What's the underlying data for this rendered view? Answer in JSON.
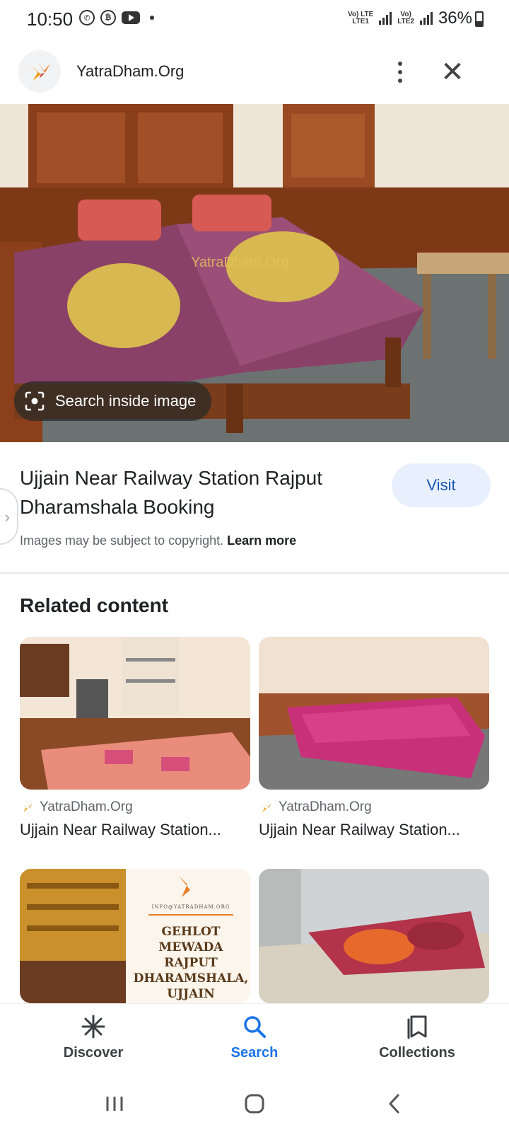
{
  "status_bar": {
    "time": "10:50",
    "network1": "Vo) LTE\nLTE1",
    "network2": "Vo)\nLTE2",
    "battery": "36%"
  },
  "header": {
    "site_name": "YatraDham.Org",
    "menu_icon": "more-vert-icon",
    "close_icon": "close-icon"
  },
  "main_image": {
    "search_inside_label": "Search inside image",
    "watermark": "YatraDham.Org"
  },
  "result": {
    "title": "Ujjain Near Railway Station Rajput Dharamshala Booking",
    "visit_label": "Visit",
    "copyright_text": "Images may be subject to copyright.",
    "learn_more": "Learn more"
  },
  "related": {
    "heading": "Related content",
    "cards": [
      {
        "source": "YatraDham.Org",
        "title": "Ujjain Near Railway Station..."
      },
      {
        "source": "YatraDham.Org",
        "title": "Ujjain Near Railway Station..."
      },
      {
        "poster_email": "INFO@YATRADHAM.ORG",
        "poster_line1": "GEHLOT",
        "poster_line2": "MEWADA",
        "poster_line3": "RAJPUT",
        "poster_line4": "DHARAMSHALA,",
        "poster_line5": "UJJAIN"
      },
      {}
    ]
  },
  "bottom_nav": {
    "items": [
      {
        "label": "Discover",
        "icon": "asterisk-icon"
      },
      {
        "label": "Search",
        "icon": "search-icon",
        "active": true
      },
      {
        "label": "Collections",
        "icon": "bookmarks-icon"
      }
    ]
  },
  "colors": {
    "accent": "#1a73e8",
    "visit_bg": "#e8f0fe",
    "brand_orange": "#f39c12"
  }
}
